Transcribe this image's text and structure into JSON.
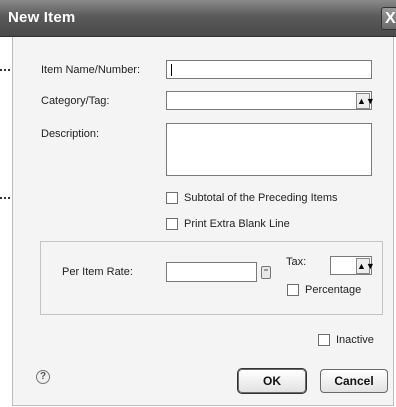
{
  "window": {
    "title": "New Item",
    "close_label": "X"
  },
  "form": {
    "item_name": {
      "label": "Item Name/Number:",
      "value": ""
    },
    "category": {
      "label": "Category/Tag:",
      "value": ""
    },
    "description": {
      "label": "Description:",
      "value": ""
    },
    "subtotal": {
      "label": "Subtotal of the Preceding Items",
      "checked": false
    },
    "blank_line": {
      "label": "Print Extra Blank Line",
      "checked": false
    },
    "rate": {
      "label": "Per Item Rate:",
      "value": ""
    },
    "tax": {
      "label": "Tax:",
      "value": ""
    },
    "percentage": {
      "label": "Percentage",
      "checked": false
    },
    "inactive": {
      "label": "Inactive",
      "checked": false
    }
  },
  "icons": {
    "dropdown": "▲▼",
    "help": "?"
  },
  "buttons": {
    "ok": "OK",
    "cancel": "Cancel"
  }
}
